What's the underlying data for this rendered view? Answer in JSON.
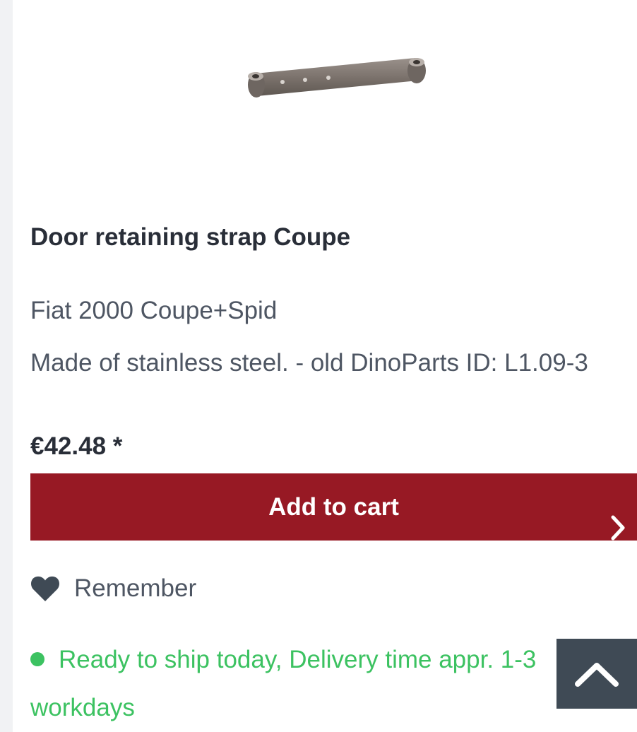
{
  "product": {
    "title": "Door retaining strap Coupe",
    "subtitle": "Fiat 2000 Coupe+Spid",
    "description": "Made of stainless steel. - old DinoParts ID: L1.09-3",
    "price": "€42.48 *"
  },
  "cart": {
    "add_label": "Add to cart",
    "icon": "chevron-right-icon"
  },
  "wishlist": {
    "label": "Remember",
    "icon": "heart-icon"
  },
  "availability": {
    "text": "Ready to ship today, Delivery time appr. 1-3 workdays",
    "status_color": "#3cc261"
  },
  "scroll_top": {
    "icon": "chevron-up-icon"
  },
  "colors": {
    "accent": "#971924",
    "text": "#292e38",
    "muted": "#4e5663",
    "success": "#3cc261",
    "scroll_button": "#3f4a55"
  }
}
